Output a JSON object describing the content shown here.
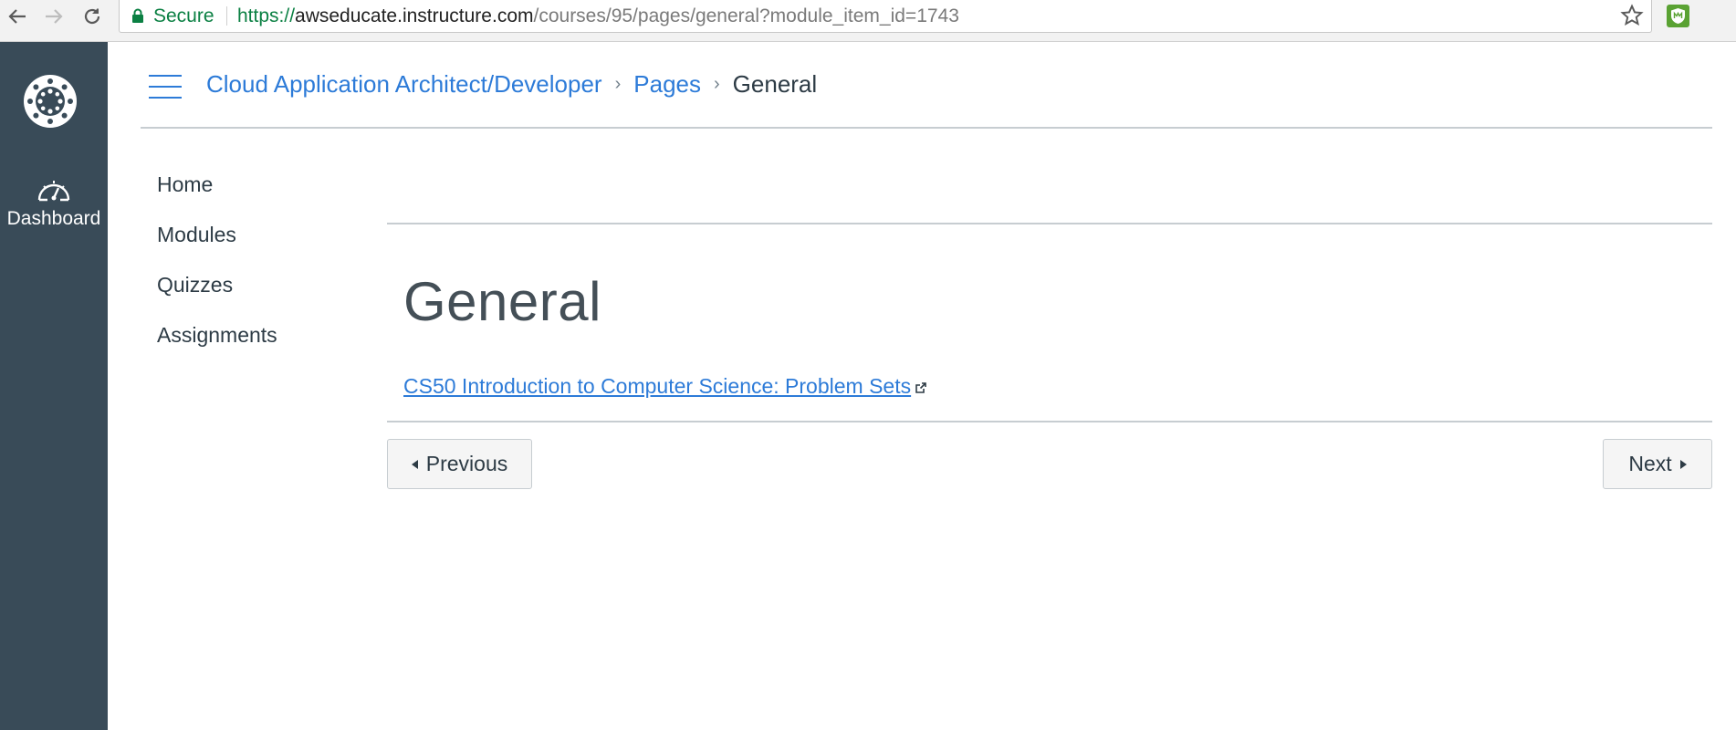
{
  "browser": {
    "secure_label": "Secure",
    "url_scheme": "https://",
    "url_host": "awseducate.instructure.com",
    "url_path": "/courses/95/pages/general?module_item_id=1743"
  },
  "global_nav": {
    "dashboard_label": "Dashboard"
  },
  "breadcrumbs": {
    "course": "Cloud Application Architect/Developer",
    "section": "Pages",
    "current": "General"
  },
  "course_nav": {
    "items": [
      {
        "label": "Home"
      },
      {
        "label": "Modules"
      },
      {
        "label": "Quizzes"
      },
      {
        "label": "Assignments"
      }
    ]
  },
  "content": {
    "title": "General",
    "link_text": "CS50 Introduction to Computer Science: Problem Sets"
  },
  "footer_nav": {
    "previous_label": "Previous",
    "next_label": "Next"
  },
  "colors": {
    "link": "#2d7bd8",
    "global_nav_bg": "#394b58",
    "secure_green": "#0b8043"
  }
}
